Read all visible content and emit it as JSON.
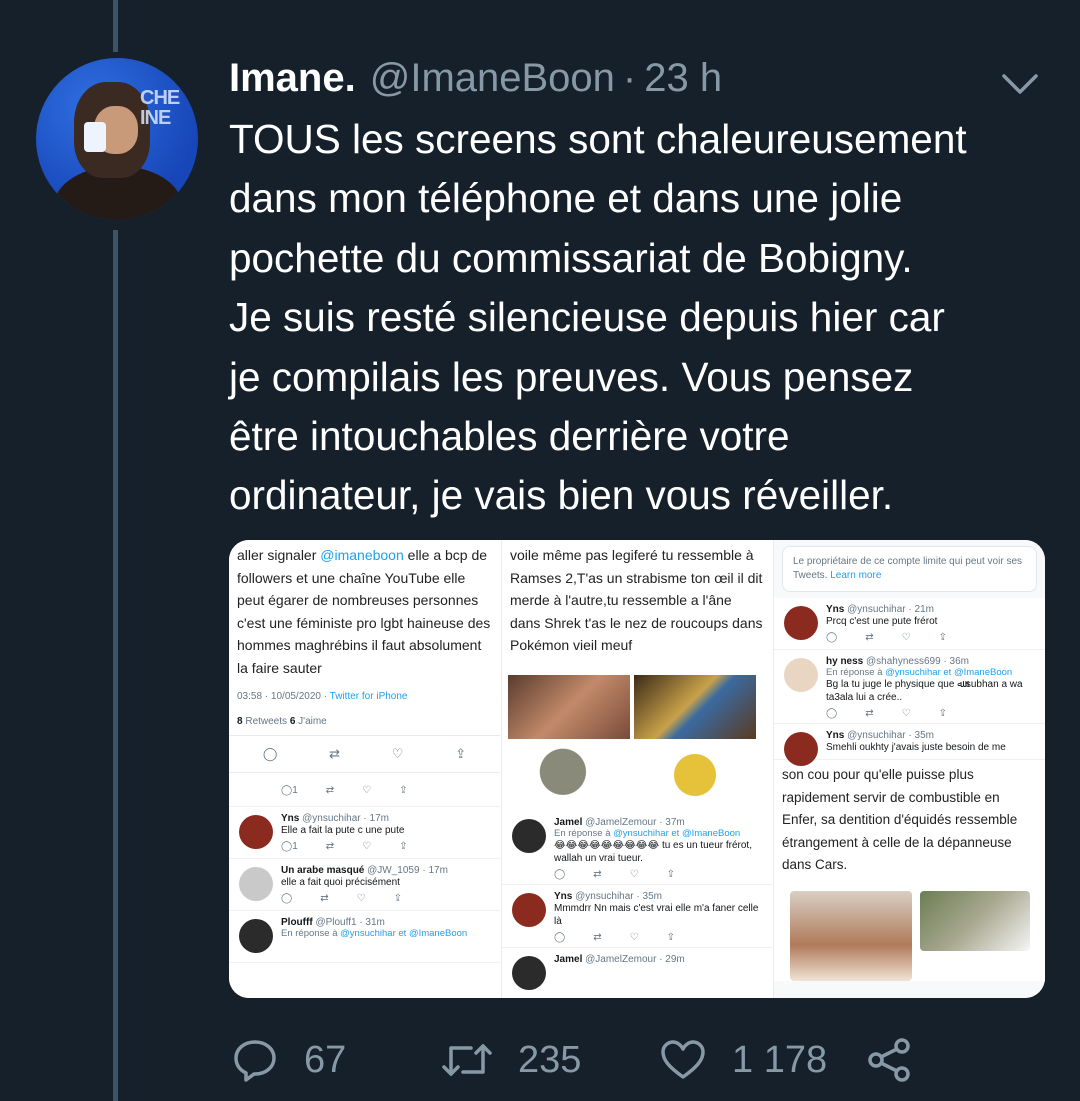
{
  "tweet": {
    "name": "Imane.",
    "handle": "@ImaneBoon",
    "separator": "·",
    "time": "23 h",
    "text": "TOUS les screens sont chaleureusement\ndans mon téléphone  et dans une jolie\npochette du commissariat de Bobigny.\nJe suis resté silencieuse depuis hier car\nje compilais les preuves. Vous pensez\nêtre intouchables derrière votre\nordinateur, je vais bien vous réveiller.",
    "avatar_sign": "CHE\nINE"
  },
  "media": {
    "panel1": {
      "text_before": "aller signaler ",
      "mention": "@imaneboon",
      "text_after": " elle a bcp de followers et une chaîne YouTube elle peut égarer de nombreuses personnes c'est une féministe pro lgbt haineuse des hommes maghrébins il faut absolument la faire sauter",
      "time": "03:58 · 10/05/2020 · ",
      "source": "Twitter for iPhone",
      "retweets_count": "8",
      "retweets_label": " Retweets ",
      "likes_count": "6",
      "likes_label": " J'aime",
      "mini_one": "1",
      "replies": [
        {
          "name": "Yns",
          "handle": "@ynsuchihar · 17m",
          "reply_to": "",
          "reply_mention": "",
          "text": "Elle a fait la pute c une pute"
        },
        {
          "name": "Un arabe masqué",
          "handle": "@JW_1059 · 17m",
          "reply_to": "",
          "reply_mention": "",
          "text": "elle a fait quoi précisément"
        },
        {
          "name": "Ploufff",
          "handle": "@Plouff1 · 31m",
          "reply_to": "En réponse à ",
          "reply_mention": "@ynsuchihar et @ImaneBoon",
          "text": ""
        }
      ]
    },
    "panel2": {
      "text": "voile même pas legiferé tu ressemble à Ramses 2,T'as un strabisme ton œil il dit merde à l'autre,tu ressemble a l'âne dans Shrek t'as le nez de roucoups dans Pokémon vieil meuf",
      "replies": [
        {
          "name": "Jamel",
          "handle": "@JamelZemour · 37m",
          "reply_to": "En réponse à ",
          "reply_mention": "@ynsuchihar et @ImaneBoon",
          "text": "😂😂😂😂😂😂😂😂😂 tu es un tueur frérot, wallah un vrai tueur."
        },
        {
          "name": "Yns",
          "handle": "@ynsuchihar · 35m",
          "reply_to": "",
          "reply_mention": "",
          "text": "Mmmdrr Nn mais c'est vrai elle m'a faner celle là"
        },
        {
          "name": "Jamel",
          "handle": "@JamelZemour · 29m",
          "reply_to": "",
          "reply_mention": "",
          "text": ""
        }
      ]
    },
    "panel3": {
      "notice": "Le propriétaire de ce compte limite qui peut voir ses Tweets. ",
      "notice_link": "Learn more",
      "replies": [
        {
          "name": "Yns",
          "handle": "@ynsuchihar · 21m",
          "reply_to": "",
          "reply_mention": "",
          "text": "Prcq c'est une pute frérot"
        },
        {
          "name": "hy ness",
          "handle": "@shahyness699 · 36m",
          "reply_to": "En réponse à ",
          "reply_mention": "@ynsuchihar et @ImaneBoon",
          "text": "Bg la tu juge le physique que ﷲ subhan a wa ta3ala lui a crée.."
        },
        {
          "name": "Yns",
          "handle": "@ynsuchihar · 35m",
          "reply_to": "",
          "reply_mention": "",
          "text": "Smehli oukhty j'avais juste besoin de me"
        }
      ],
      "text": "son cou pour qu'elle puisse plus rapidement servir de combustible en Enfer, sa dentition d'équidés ressemble étrangement à celle de la dépanneuse dans Cars."
    }
  },
  "actions": {
    "reply_count": "67",
    "retweet_count": "235",
    "like_count": "1 178"
  },
  "colors": {
    "background": "#15202b",
    "secondary_text": "#8899a6",
    "thread_line": "#3d5466",
    "link": "#1da1f2"
  }
}
